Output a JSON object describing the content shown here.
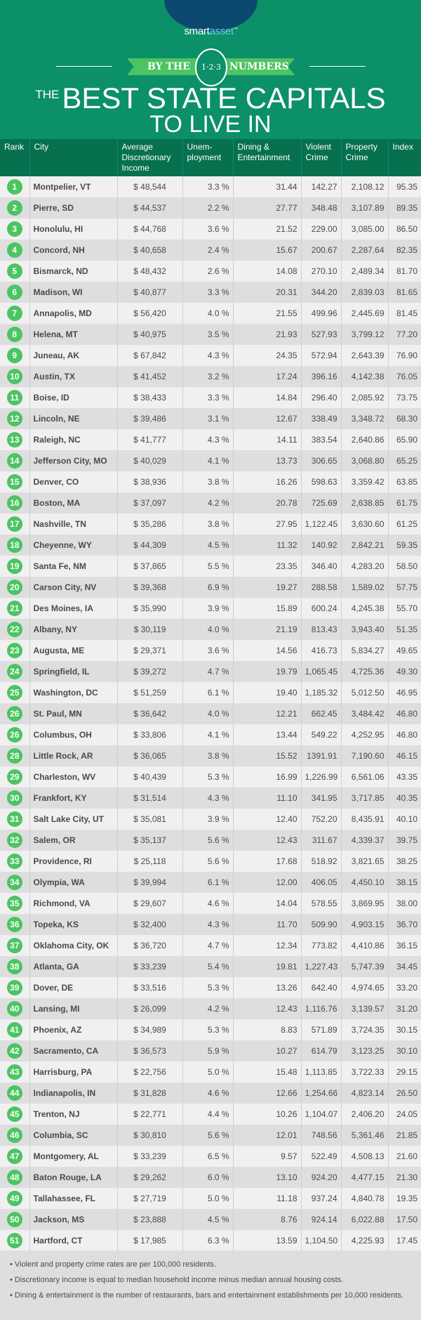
{
  "brand": {
    "part1": "smart",
    "part2": "asset",
    "tm": "™"
  },
  "banner": {
    "left": "BY THE",
    "badge": "1·2·3",
    "right": "NUMBERS"
  },
  "title": {
    "the": "THE",
    "line1": "BEST STATE CAPITALS",
    "line2": "TO LIVE IN"
  },
  "colors": {
    "background": "#0b9068",
    "header": "#07704f",
    "rank_circle": "#4cc462",
    "logo": "#0b4a6e"
  },
  "table": {
    "headers": [
      "Rank",
      "City",
      "Average Discretionary Income",
      "Unem-ployment",
      "Dining & Entertainment",
      "Violent Crime",
      "Property Crime",
      "Index"
    ],
    "rows": [
      [
        "1",
        "Montpelier, VT",
        "$ 48,544",
        "3.3 %",
        "31.44",
        "142.27",
        "2,108.12",
        "95.35"
      ],
      [
        "2",
        "Pierre, SD",
        "$ 44,537",
        "2.2 %",
        "27.77",
        "348.48",
        "3,107.89",
        "89.35"
      ],
      [
        "3",
        "Honolulu, HI",
        "$ 44,768",
        "3.6 %",
        "21.52",
        "229.00",
        "3,085.00",
        "86.50"
      ],
      [
        "4",
        "Concord, NH",
        "$ 40,658",
        "2.4 %",
        "15.67",
        "200.67",
        "2,287.64",
        "82.35"
      ],
      [
        "5",
        "Bismarck, ND",
        "$ 48,432",
        "2.6 %",
        "14.08",
        "270.10",
        "2,489.34",
        "81.70"
      ],
      [
        "6",
        "Madison, WI",
        "$ 40,877",
        "3.3 %",
        "20.31",
        "344.20",
        "2,839.03",
        "81.65"
      ],
      [
        "7",
        "Annapolis, MD",
        "$ 56,420",
        "4.0 %",
        "21.55",
        "499.96",
        "2,445.69",
        "81.45"
      ],
      [
        "8",
        "Helena, MT",
        "$ 40,975",
        "3.5 %",
        "21.93",
        "527.93",
        "3,799.12",
        "77.20"
      ],
      [
        "9",
        "Juneau, AK",
        "$ 67,842",
        "4.3 %",
        "24.35",
        "572.94",
        "2,643.39",
        "76.90"
      ],
      [
        "10",
        "Austin, TX",
        "$ 41,452",
        "3.2 %",
        "17.24",
        "396.16",
        "4,142.38",
        "76.05"
      ],
      [
        "11",
        "Boise, ID",
        "$ 38,433",
        "3.3 %",
        "14.84",
        "296.40",
        "2,085.92",
        "73.75"
      ],
      [
        "12",
        "Lincoln, NE",
        "$ 39,486",
        "3.1 %",
        "12.67",
        "338.49",
        "3,348.72",
        "68.30"
      ],
      [
        "13",
        "Raleigh, NC",
        "$ 41,777",
        "4.3 %",
        "14.11",
        "383.54",
        "2,640.86",
        "65.90"
      ],
      [
        "14",
        "Jefferson City, MO",
        "$ 40,029",
        "4.1 %",
        "13.73",
        "306.65",
        "3,068.80",
        "65.25"
      ],
      [
        "15",
        "Denver, CO",
        "$ 38,936",
        "3.8 %",
        "16.26",
        "598.63",
        "3,359.42",
        "63.85"
      ],
      [
        "16",
        "Boston, MA",
        "$ 37,097",
        "4.2 %",
        "20.78",
        "725.69",
        "2,638.85",
        "61.75"
      ],
      [
        "17",
        "Nashville, TN",
        "$ 35,286",
        "3.8 %",
        "27.95",
        "1,122.45",
        "3,630.60",
        "61.25"
      ],
      [
        "18",
        "Cheyenne, WY",
        "$ 44,309",
        "4.5 %",
        "11.32",
        "140.92",
        "2,842.21",
        "59.35"
      ],
      [
        "19",
        "Santa Fe, NM",
        "$ 37,865",
        "5.5 %",
        "23.35",
        "346.40",
        "4,283.20",
        "58.50"
      ],
      [
        "20",
        "Carson City, NV",
        "$ 39,368",
        "6.9 %",
        "19.27",
        "288.58",
        "1,589.02",
        "57.75"
      ],
      [
        "21",
        "Des Moines, IA",
        "$ 35,990",
        "3.9 %",
        "15.89",
        "600.24",
        "4,245.38",
        "55.70"
      ],
      [
        "22",
        "Albany, NY",
        "$ 30,119",
        "4.0 %",
        "21.19",
        "813.43",
        "3,943.40",
        "51.35"
      ],
      [
        "23",
        "Augusta, ME",
        "$ 29,371",
        "3.6 %",
        "14.56",
        "416.73",
        "5,834.27",
        "49.65"
      ],
      [
        "24",
        "Springfield, IL",
        "$ 39,272",
        "4.7 %",
        "19.79",
        "1,065.45",
        "4,725.36",
        "49.30"
      ],
      [
        "25",
        "Washington, DC",
        "$ 51,259",
        "6.1 %",
        "19.40",
        "1,185.32",
        "5,012.50",
        "46.95"
      ],
      [
        "26",
        "St. Paul, MN",
        "$ 36,642",
        "4.0 %",
        "12.21",
        "662.45",
        "3,484.42",
        "46.80"
      ],
      [
        "26",
        "Columbus, OH",
        "$ 33,806",
        "4.1 %",
        "13.44",
        "549.22",
        "4,252.95",
        "46.80"
      ],
      [
        "28",
        "Little Rock, AR",
        "$ 36,065",
        "3.8 %",
        "15.52",
        "1391.91",
        "7,190.60",
        "46.15"
      ],
      [
        "29",
        "Charleston, WV",
        "$ 40,439",
        "5.3 %",
        "16.99",
        "1,226.99",
        "6,561.06",
        "43.35"
      ],
      [
        "30",
        "Frankfort, KY",
        "$ 31,514",
        "4.3 %",
        "11.10",
        "341.95",
        "3,717.85",
        "40.35"
      ],
      [
        "31",
        "Salt Lake City, UT",
        "$ 35,081",
        "3.9 %",
        "12.40",
        "752.20",
        "8,435.91",
        "40.10"
      ],
      [
        "32",
        "Salem, OR",
        "$ 35,137",
        "5.6 %",
        "12.43",
        "311.67",
        "4,339.37",
        "39.75"
      ],
      [
        "33",
        "Providence, RI",
        "$ 25,118",
        "5.6 %",
        "17.68",
        "518.92",
        "3,821.65",
        "38.25"
      ],
      [
        "34",
        "Olympia, WA",
        "$ 39,994",
        "6.1 %",
        "12.00",
        "406.05",
        "4,450.10",
        "38.15"
      ],
      [
        "35",
        "Richmond, VA",
        "$ 29,607",
        "4.6 %",
        "14.04",
        "578.55",
        "3,869.95",
        "38.00"
      ],
      [
        "36",
        "Topeka, KS",
        "$ 32,400",
        "4.3 %",
        "11.70",
        "509.90",
        "4,903.15",
        "36.70"
      ],
      [
        "37",
        "Oklahoma City, OK",
        "$ 36,720",
        "4.7 %",
        "12.34",
        "773.82",
        "4,410.86",
        "36.15"
      ],
      [
        "38",
        "Atlanta, GA",
        "$ 33,239",
        "5.4 %",
        "19.81",
        "1,227.43",
        "5,747.39",
        "34.45"
      ],
      [
        "39",
        "Dover, DE",
        "$ 33,516",
        "5.3 %",
        "13.26",
        "642.40",
        "4,974.65",
        "33.20"
      ],
      [
        "40",
        "Lansing, MI",
        "$ 26,099",
        "4.2 %",
        "12.43",
        "1,116.76",
        "3,139.57",
        "31.20"
      ],
      [
        "41",
        "Phoenix, AZ",
        "$ 34,989",
        "5.3 %",
        "8.83",
        "571.89",
        "3,724.35",
        "30.15"
      ],
      [
        "42",
        "Sacramento, CA",
        "$ 36,573",
        "5.9 %",
        "10.27",
        "614.79",
        "3,123.25",
        "30.10"
      ],
      [
        "43",
        "Harrisburg, PA",
        "$ 22,756",
        "5.0 %",
        "15.48",
        "1,113.85",
        "3,722.33",
        "29.15"
      ],
      [
        "44",
        "Indianapolis, IN",
        "$ 31,828",
        "4.6 %",
        "12.66",
        "1,254.66",
        "4,823.14",
        "26.50"
      ],
      [
        "45",
        "Trenton, NJ",
        "$ 22,771",
        "4.4 %",
        "10.26",
        "1,104.07",
        "2,406.20",
        "24.05"
      ],
      [
        "46",
        "Columbia, SC",
        "$ 30,810",
        "5.6 %",
        "12.01",
        "748.56",
        "5,361.46",
        "21.85"
      ],
      [
        "47",
        "Montgomery, AL",
        "$ 33,239",
        "6.5 %",
        "9.57",
        "522.49",
        "4,508.13",
        "21.60"
      ],
      [
        "48",
        "Baton Rouge, LA",
        "$ 29,262",
        "6.0 %",
        "13.10",
        "924.20",
        "4,477.15",
        "21.30"
      ],
      [
        "49",
        "Tallahassee, FL",
        "$ 27,719",
        "5.0 %",
        "11.18",
        "937.24",
        "4,840.78",
        "19.35"
      ],
      [
        "50",
        "Jackson, MS",
        "$ 23,888",
        "4.5 %",
        "8.76",
        "924.14",
        "6,022.88",
        "17.50"
      ],
      [
        "51",
        "Hartford, CT",
        "$ 17,985",
        "6.3 %",
        "13.59",
        "1,104.50",
        "4,225.93",
        "17.45"
      ]
    ]
  },
  "notes": [
    "• Violent and property crime rates are per 100,000 residents.",
    "• Discretionary income is equal to median household income minus median annual housing costs.",
    "• Dining & entertainment is the number of restaurants, bars and entertainment establishments per 10,000 residents."
  ]
}
